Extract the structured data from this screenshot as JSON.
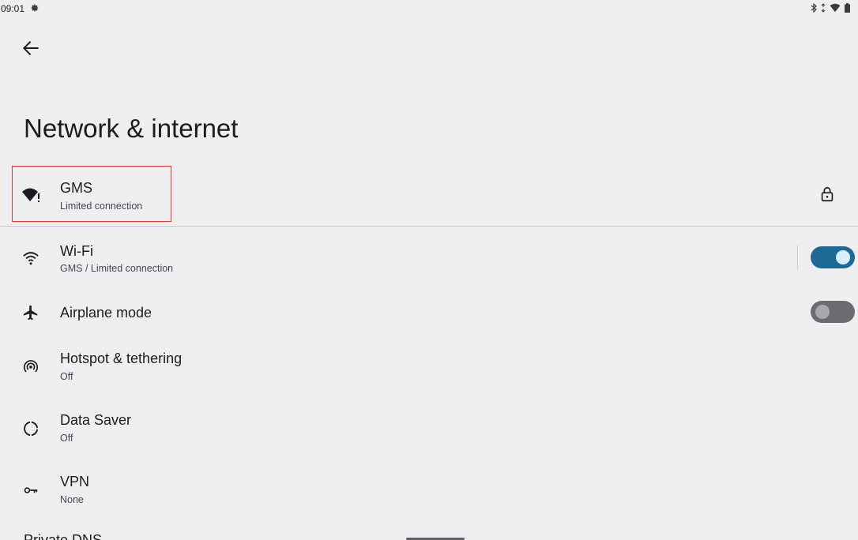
{
  "status_bar": {
    "time": "09:01",
    "icons": [
      "settings-icon",
      "bluetooth-icon",
      "data-arrows-icon",
      "wifi-limited-icon",
      "battery-icon"
    ]
  },
  "header": {
    "back_icon": "arrow-back-icon",
    "title": "Network & internet"
  },
  "current_network": {
    "name": "GMS",
    "status": "Limited connection",
    "icon": "wifi-limited-icon",
    "trailing_icon": "lock-icon"
  },
  "settings": [
    {
      "id": "wifi",
      "title": "Wi-Fi",
      "subtitle": "GMS / Limited connection",
      "icon": "wifi-icon",
      "toggle": true
    },
    {
      "id": "airplane",
      "title": "Airplane mode",
      "subtitle": "",
      "icon": "airplane-icon",
      "toggle": false
    },
    {
      "id": "hotspot",
      "title": "Hotspot & tethering",
      "subtitle": "Off",
      "icon": "hotspot-icon"
    },
    {
      "id": "data-saver",
      "title": "Data Saver",
      "subtitle": "Off",
      "icon": "data-saver-icon"
    },
    {
      "id": "vpn",
      "title": "VPN",
      "subtitle": "None",
      "icon": "vpn-key-icon"
    }
  ],
  "partial_row": "Private DNS",
  "colors": {
    "background": "#efeff2",
    "toggle_on": "#1e6a96",
    "toggle_off": "#6b6b70",
    "highlight": "#e53935"
  }
}
